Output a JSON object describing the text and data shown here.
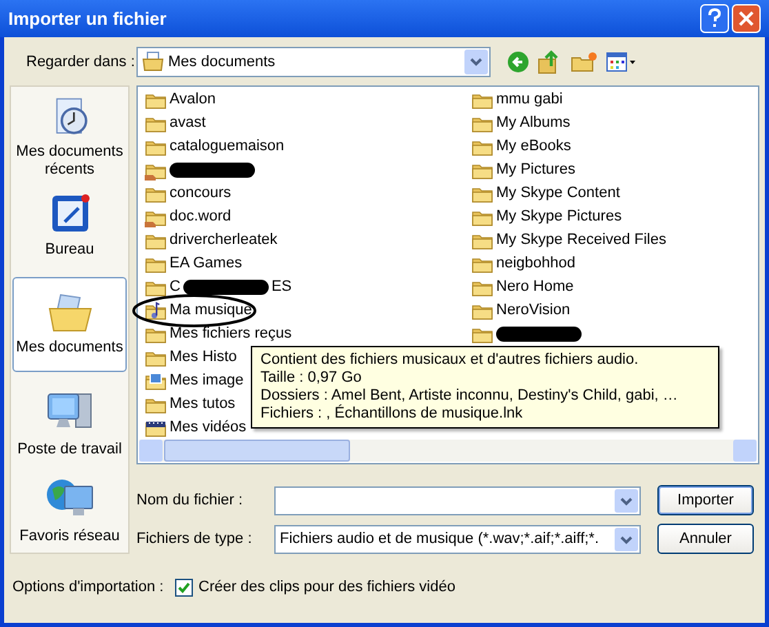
{
  "window": {
    "title": "Importer un fichier"
  },
  "look_in": {
    "label": "Regarder dans :",
    "value": "Mes documents"
  },
  "places": [
    {
      "label": "Mes documents récents",
      "kind": "recent",
      "selected": false
    },
    {
      "label": "Bureau",
      "kind": "desktop",
      "selected": false
    },
    {
      "label": "Mes documents",
      "kind": "documents",
      "selected": true
    },
    {
      "label": "Poste de travail",
      "kind": "computer",
      "selected": false
    },
    {
      "label": "Favoris réseau",
      "kind": "network",
      "selected": false
    }
  ],
  "files": {
    "column_1": [
      {
        "name": "Avalon",
        "kind": "folder"
      },
      {
        "name": "avast",
        "kind": "folder"
      },
      {
        "name": "cataloguemaison",
        "kind": "folder"
      },
      {
        "kind": "shared",
        "redacted": true
      },
      {
        "name": "concours",
        "kind": "folder"
      },
      {
        "name": "doc.word",
        "kind": "shared"
      },
      {
        "name": "drivercherleatek",
        "kind": "folder"
      },
      {
        "name": "EA Games",
        "kind": "folder"
      },
      {
        "name_start": "C",
        "name": "ES",
        "kind": "folder",
        "redacted": true
      },
      {
        "name": "Ma musique",
        "kind": "music",
        "circled": true
      },
      {
        "name": "Mes fichiers reçus",
        "kind": "folder"
      },
      {
        "name": "Mes Histo",
        "kind": "folder"
      },
      {
        "name": "Mes image",
        "kind": "pictures"
      },
      {
        "name": "Mes tutos",
        "kind": "folder"
      },
      {
        "name": "Mes vidéos",
        "kind": "videos"
      }
    ],
    "column_2": [
      {
        "name": "mmu gabi",
        "kind": "folder"
      },
      {
        "name": "My Albums",
        "kind": "folder"
      },
      {
        "name": "My eBooks",
        "kind": "folder"
      },
      {
        "name": "My Pictures",
        "kind": "folder"
      },
      {
        "name": "My Skype Content",
        "kind": "folder"
      },
      {
        "name": "My Skype Pictures",
        "kind": "folder"
      },
      {
        "name": "My Skype Received Files",
        "kind": "folder"
      },
      {
        "name": "neigbohhod",
        "kind": "folder"
      },
      {
        "name": "Nero Home",
        "kind": "folder"
      },
      {
        "name": "NeroVision",
        "kind": "folder"
      },
      {
        "kind": "folder",
        "redacted": true
      }
    ]
  },
  "tooltip": [
    "Contient des fichiers musicaux et d'autres fichiers audio.",
    "Taille : 0,97 Go",
    "Dossiers : Amel Bent, Artiste inconnu, Destiny's Child, gabi, …",
    "Fichiers : , Échantillons de musique.lnk"
  ],
  "filename": {
    "label": "Nom du fichier :"
  },
  "filetype": {
    "label": "Fichiers de type :",
    "value": "Fichiers audio et de musique (*.wav;*.aif;*.aiff;*."
  },
  "buttons": [
    "Importer",
    "Annuler"
  ],
  "options": {
    "label": "Options d'importation :",
    "checkbox": {
      "label": "Créer des clips pour des fichiers vidéo",
      "checked": true
    }
  }
}
